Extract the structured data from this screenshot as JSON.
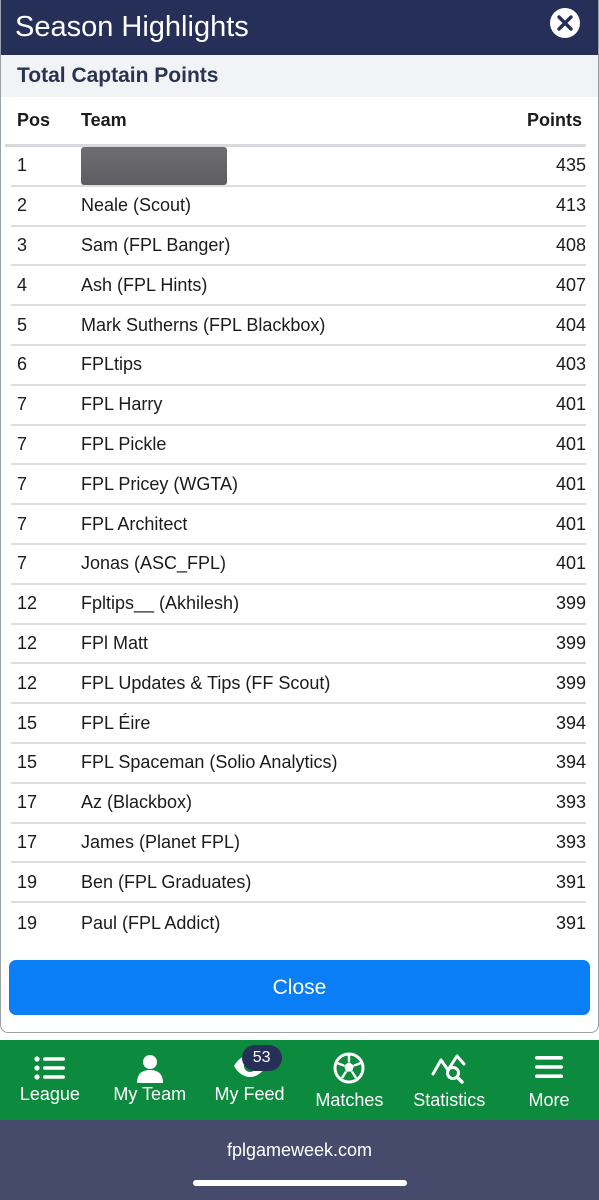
{
  "modal": {
    "title": "Season Highlights",
    "section_title": "Total Captain Points",
    "columns": {
      "pos": "Pos",
      "team": "Team",
      "points": "Points"
    },
    "rows": [
      {
        "pos": "1",
        "team": "",
        "points": "435",
        "redacted": true
      },
      {
        "pos": "2",
        "team": "Neale (Scout)",
        "points": "413"
      },
      {
        "pos": "3",
        "team": "Sam (FPL Banger)",
        "points": "408"
      },
      {
        "pos": "4",
        "team": "Ash (FPL Hints)",
        "points": "407"
      },
      {
        "pos": "5",
        "team": "Mark Sutherns (FPL Blackbox)",
        "points": "404"
      },
      {
        "pos": "6",
        "team": "FPLtips",
        "points": "403"
      },
      {
        "pos": "7",
        "team": "FPL Harry",
        "points": "401"
      },
      {
        "pos": "7",
        "team": "FPL Pickle",
        "points": "401"
      },
      {
        "pos": "7",
        "team": "FPL Pricey (WGTA)",
        "points": "401"
      },
      {
        "pos": "7",
        "team": "FPL Architect",
        "points": "401"
      },
      {
        "pos": "7",
        "team": "Jonas (ASC_FPL)",
        "points": "401"
      },
      {
        "pos": "12",
        "team": "Fpltips__ (Akhilesh)",
        "points": "399"
      },
      {
        "pos": "12",
        "team": "FPl Matt",
        "points": "399"
      },
      {
        "pos": "12",
        "team": "FPL Updates & Tips (FF Scout)",
        "points": "399"
      },
      {
        "pos": "15",
        "team": "FPL Éire",
        "points": "394"
      },
      {
        "pos": "15",
        "team": "FPL Spaceman (Solio Analytics)",
        "points": "394"
      },
      {
        "pos": "17",
        "team": "Az (Blackbox)",
        "points": "393"
      },
      {
        "pos": "17",
        "team": "James (Planet FPL)",
        "points": "393"
      },
      {
        "pos": "19",
        "team": "Ben (FPL Graduates)",
        "points": "391"
      },
      {
        "pos": "19",
        "team": "Paul (FPL Addict)",
        "points": "391"
      }
    ],
    "close_label": "Close",
    "close_icon": "close-circle-icon"
  },
  "nav": {
    "items": [
      {
        "label": "League",
        "icon": "list-icon"
      },
      {
        "label": "My Team",
        "icon": "person-icon"
      },
      {
        "label": "My Feed",
        "icon": "eye-icon",
        "badge": "53"
      },
      {
        "label": "Matches",
        "icon": "football-icon"
      },
      {
        "label": "Statistics",
        "icon": "stats-search-icon"
      },
      {
        "label": "More",
        "icon": "menu-icon"
      }
    ]
  },
  "footer": {
    "url": "fplgameweek.com"
  },
  "colors": {
    "header_bg": "#262f57",
    "primary_button": "#0a7ef5",
    "nav_bg": "#0c8a3e",
    "footer_bg": "#474b6b"
  }
}
